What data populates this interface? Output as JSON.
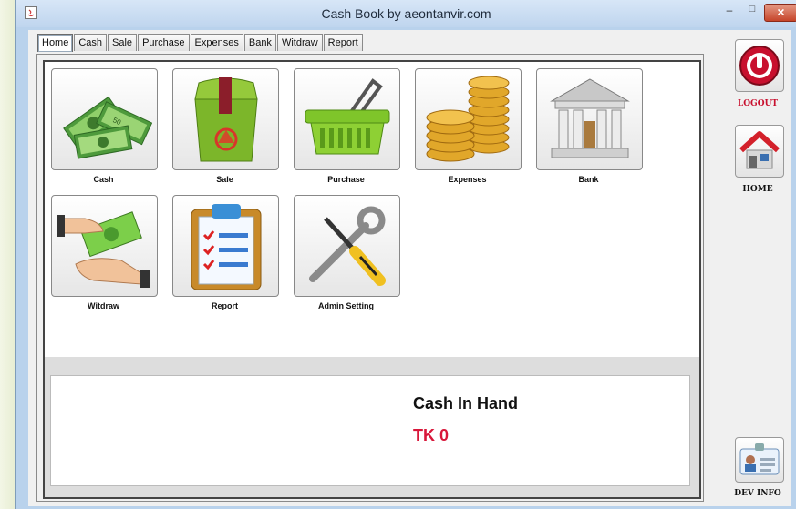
{
  "window": {
    "title": "Cash Book by aeontanvir.com",
    "close_glyph": "×",
    "min_glyph": "–",
    "max_glyph": "□"
  },
  "tabs": [
    "Home",
    "Cash",
    "Sale",
    "Purchase",
    "Expenses",
    "Bank",
    "Witdraw",
    "Report"
  ],
  "active_tab": "Home",
  "modules": {
    "cash": "Cash",
    "sale": "Sale",
    "purchase": "Purchase",
    "expenses": "Expenses",
    "bank": "Bank",
    "witdraw": "Witdraw",
    "report": "Report",
    "admin": "Admin Setting"
  },
  "summary": {
    "title": "Cash In Hand",
    "value": "TK  0"
  },
  "side": {
    "logout": "LOGOUT",
    "home": "HOME",
    "devinfo": "DEV INFO"
  },
  "icons": {
    "cash": "money-stack-icon",
    "sale": "shopping-bag-icon",
    "purchase": "basket-icon",
    "expenses": "coins-icon",
    "bank": "bank-building-icon",
    "witdraw": "hand-money-icon",
    "report": "clipboard-icon",
    "admin": "tools-icon",
    "logout": "power-icon",
    "home": "house-icon",
    "devinfo": "id-card-icon"
  },
  "colors": {
    "accent_red": "#d8173a",
    "titlebar": "#bfd5ee"
  }
}
